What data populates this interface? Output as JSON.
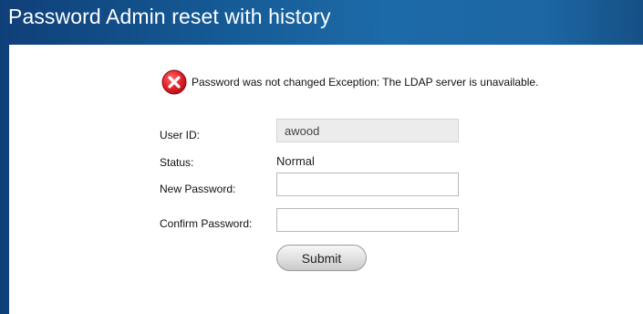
{
  "header": {
    "title": "Password Admin reset with history"
  },
  "alert": {
    "icon": "error-x-icon",
    "color": "#e0202a",
    "message": "Password was not changed Exception: The LDAP server is unavailable."
  },
  "form": {
    "user_id_label": "User ID:",
    "user_id_value": "awood",
    "status_label": "Status:",
    "status_value": "Normal",
    "new_password_label": "New Password:",
    "new_password_value": "",
    "confirm_password_label": "Confirm Password:",
    "confirm_password_value": "",
    "submit_label": "Submit"
  }
}
